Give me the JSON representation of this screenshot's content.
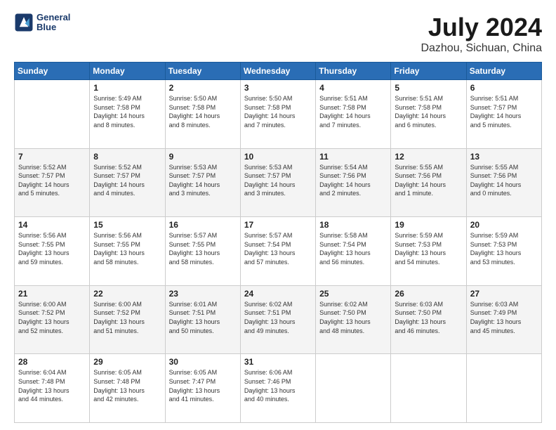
{
  "header": {
    "logo_line1": "General",
    "logo_line2": "Blue",
    "title": "July 2024",
    "subtitle": "Dazhou, Sichuan, China"
  },
  "weekdays": [
    "Sunday",
    "Monday",
    "Tuesday",
    "Wednesday",
    "Thursday",
    "Friday",
    "Saturday"
  ],
  "weeks": [
    [
      {
        "day": "",
        "info": ""
      },
      {
        "day": "1",
        "info": "Sunrise: 5:49 AM\nSunset: 7:58 PM\nDaylight: 14 hours\nand 8 minutes."
      },
      {
        "day": "2",
        "info": "Sunrise: 5:50 AM\nSunset: 7:58 PM\nDaylight: 14 hours\nand 8 minutes."
      },
      {
        "day": "3",
        "info": "Sunrise: 5:50 AM\nSunset: 7:58 PM\nDaylight: 14 hours\nand 7 minutes."
      },
      {
        "day": "4",
        "info": "Sunrise: 5:51 AM\nSunset: 7:58 PM\nDaylight: 14 hours\nand 7 minutes."
      },
      {
        "day": "5",
        "info": "Sunrise: 5:51 AM\nSunset: 7:58 PM\nDaylight: 14 hours\nand 6 minutes."
      },
      {
        "day": "6",
        "info": "Sunrise: 5:51 AM\nSunset: 7:57 PM\nDaylight: 14 hours\nand 5 minutes."
      }
    ],
    [
      {
        "day": "7",
        "info": "Sunrise: 5:52 AM\nSunset: 7:57 PM\nDaylight: 14 hours\nand 5 minutes."
      },
      {
        "day": "8",
        "info": "Sunrise: 5:52 AM\nSunset: 7:57 PM\nDaylight: 14 hours\nand 4 minutes."
      },
      {
        "day": "9",
        "info": "Sunrise: 5:53 AM\nSunset: 7:57 PM\nDaylight: 14 hours\nand 3 minutes."
      },
      {
        "day": "10",
        "info": "Sunrise: 5:53 AM\nSunset: 7:57 PM\nDaylight: 14 hours\nand 3 minutes."
      },
      {
        "day": "11",
        "info": "Sunrise: 5:54 AM\nSunset: 7:56 PM\nDaylight: 14 hours\nand 2 minutes."
      },
      {
        "day": "12",
        "info": "Sunrise: 5:55 AM\nSunset: 7:56 PM\nDaylight: 14 hours\nand 1 minute."
      },
      {
        "day": "13",
        "info": "Sunrise: 5:55 AM\nSunset: 7:56 PM\nDaylight: 14 hours\nand 0 minutes."
      }
    ],
    [
      {
        "day": "14",
        "info": "Sunrise: 5:56 AM\nSunset: 7:55 PM\nDaylight: 13 hours\nand 59 minutes."
      },
      {
        "day": "15",
        "info": "Sunrise: 5:56 AM\nSunset: 7:55 PM\nDaylight: 13 hours\nand 58 minutes."
      },
      {
        "day": "16",
        "info": "Sunrise: 5:57 AM\nSunset: 7:55 PM\nDaylight: 13 hours\nand 58 minutes."
      },
      {
        "day": "17",
        "info": "Sunrise: 5:57 AM\nSunset: 7:54 PM\nDaylight: 13 hours\nand 57 minutes."
      },
      {
        "day": "18",
        "info": "Sunrise: 5:58 AM\nSunset: 7:54 PM\nDaylight: 13 hours\nand 56 minutes."
      },
      {
        "day": "19",
        "info": "Sunrise: 5:59 AM\nSunset: 7:53 PM\nDaylight: 13 hours\nand 54 minutes."
      },
      {
        "day": "20",
        "info": "Sunrise: 5:59 AM\nSunset: 7:53 PM\nDaylight: 13 hours\nand 53 minutes."
      }
    ],
    [
      {
        "day": "21",
        "info": "Sunrise: 6:00 AM\nSunset: 7:52 PM\nDaylight: 13 hours\nand 52 minutes."
      },
      {
        "day": "22",
        "info": "Sunrise: 6:00 AM\nSunset: 7:52 PM\nDaylight: 13 hours\nand 51 minutes."
      },
      {
        "day": "23",
        "info": "Sunrise: 6:01 AM\nSunset: 7:51 PM\nDaylight: 13 hours\nand 50 minutes."
      },
      {
        "day": "24",
        "info": "Sunrise: 6:02 AM\nSunset: 7:51 PM\nDaylight: 13 hours\nand 49 minutes."
      },
      {
        "day": "25",
        "info": "Sunrise: 6:02 AM\nSunset: 7:50 PM\nDaylight: 13 hours\nand 48 minutes."
      },
      {
        "day": "26",
        "info": "Sunrise: 6:03 AM\nSunset: 7:50 PM\nDaylight: 13 hours\nand 46 minutes."
      },
      {
        "day": "27",
        "info": "Sunrise: 6:03 AM\nSunset: 7:49 PM\nDaylight: 13 hours\nand 45 minutes."
      }
    ],
    [
      {
        "day": "28",
        "info": "Sunrise: 6:04 AM\nSunset: 7:48 PM\nDaylight: 13 hours\nand 44 minutes."
      },
      {
        "day": "29",
        "info": "Sunrise: 6:05 AM\nSunset: 7:48 PM\nDaylight: 13 hours\nand 42 minutes."
      },
      {
        "day": "30",
        "info": "Sunrise: 6:05 AM\nSunset: 7:47 PM\nDaylight: 13 hours\nand 41 minutes."
      },
      {
        "day": "31",
        "info": "Sunrise: 6:06 AM\nSunset: 7:46 PM\nDaylight: 13 hours\nand 40 minutes."
      },
      {
        "day": "",
        "info": ""
      },
      {
        "day": "",
        "info": ""
      },
      {
        "day": "",
        "info": ""
      }
    ]
  ]
}
